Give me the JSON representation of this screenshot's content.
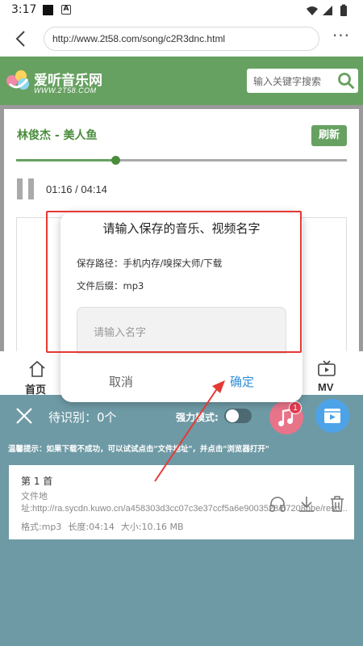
{
  "status_bar": {
    "time": "3:17",
    "a_icon": "A"
  },
  "browser": {
    "url": "http://www.2t58.com/song/c2R3dnc.html"
  },
  "site": {
    "title": "爱听音乐网",
    "subtitle": "WWW.2T58.COM",
    "search_placeholder": "输入关键字搜索",
    "brand_color": "#67a161"
  },
  "player": {
    "song_title": "林俊杰 - 美人鱼",
    "refresh_label": "刷新",
    "time": "01:16 / 04:14",
    "progress": 0.3
  },
  "nav": {
    "home_label": "首页",
    "mv_label": "MV"
  },
  "dialog": {
    "title": "请输入保存的音乐、视频名字",
    "save_path": "保存路径：手机内存/嗅探大师/下载",
    "extension": "文件后缀：mp3",
    "input_placeholder": "请输入名字",
    "cancel_label": "取消",
    "ok_label": "确定",
    "ok_color": "#2f8fd8"
  },
  "download_panel": {
    "pending": "待识别：0个",
    "force_label": "强力模式:",
    "force_mode_on": false,
    "music_badge": "1",
    "tip": "温馨提示：如果下载不成功，可以试试点击\"文件地址\"，并点击\"浏览器打开\"",
    "item": {
      "title": "第 1 首",
      "address": "文件地址:http://ra.sycdn.kuwo.cn/a458303d3cc07c3e37ccf5a6e9003528/67208bbe/reso...",
      "format": "格式:mp3",
      "length": "长度:04:14",
      "size": "大小:10.16 MB"
    }
  },
  "annotation": {
    "highlight_color": "#e53935"
  }
}
